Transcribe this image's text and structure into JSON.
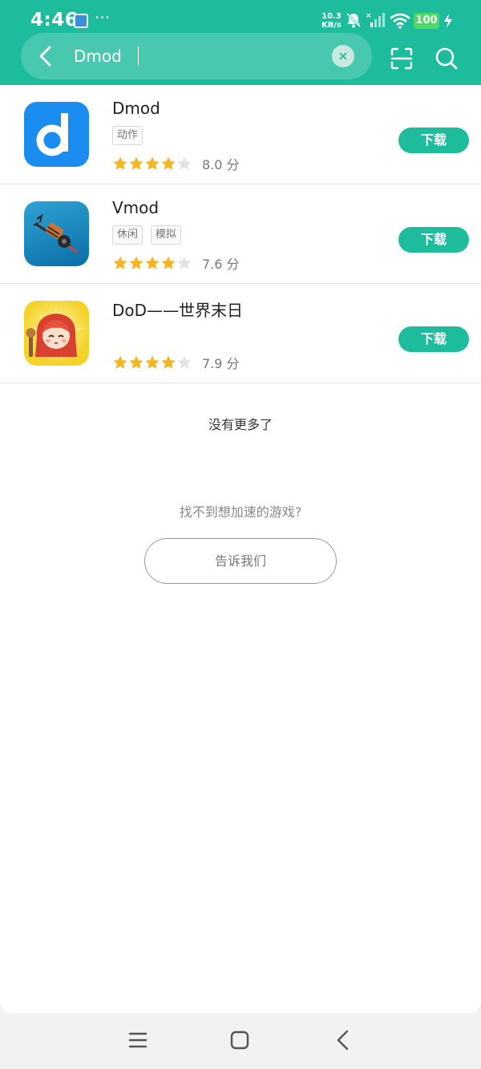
{
  "status_bar": {
    "time": "4:46",
    "speed_value": "10.3",
    "speed_unit": "KB/s",
    "battery": "100",
    "dots": "···"
  },
  "search": {
    "value": "Dmod",
    "clear_symbol": "×"
  },
  "results": [
    {
      "name": "Dmod",
      "tags": [
        "动作"
      ],
      "rating_stars": 4,
      "score": "8.0 分",
      "button": "下载",
      "icon": "dmod-app-icon"
    },
    {
      "name": "Vmod",
      "tags": [
        "休闲",
        "模拟"
      ],
      "rating_stars": 4,
      "score": "7.6 分",
      "button": "下载",
      "icon": "vmod-app-icon"
    },
    {
      "name": "DoD——世界末日",
      "tags": [],
      "rating_stars": 4,
      "score": "7.9 分",
      "button": "下载",
      "icon": "dod-app-icon"
    }
  ],
  "footer": {
    "no_more": "没有更多了",
    "cant_find": "找不到想加速的游戏?",
    "tell_us": "告诉我们"
  },
  "colors": {
    "accent": "#1dbc9c",
    "star": "#f5b521",
    "star_empty": "#e3e3e3"
  }
}
